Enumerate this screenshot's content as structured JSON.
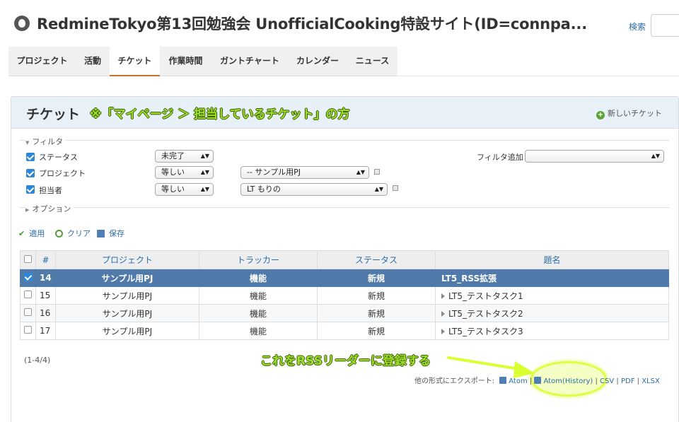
{
  "header": {
    "site_title": "RedmineTokyo第13回勉強会 UnofficialCooking特設サイト(ID=connpa...",
    "search_label": "検索"
  },
  "tabs": [
    {
      "label": "プロジェクト"
    },
    {
      "label": "活動"
    },
    {
      "label": "チケット",
      "selected": true
    },
    {
      "label": "作業時間"
    },
    {
      "label": "ガントチャート"
    },
    {
      "label": "カレンダー"
    },
    {
      "label": "ニュース"
    }
  ],
  "page": {
    "title": "チケット",
    "annotation": "※「マイページ ＞ 担当しているチケット」の方",
    "new_issue": "新しいチケット"
  },
  "filters": {
    "legend": "フィルタ",
    "add_filter_label": "フィルタ追加",
    "rows": [
      {
        "label": "ステータス",
        "operator": "未完了",
        "value": ""
      },
      {
        "label": "プロジェクト",
        "operator": "等しい",
        "value": "-- サンプル用PJ"
      },
      {
        "label": "担当者",
        "operator": "等しい",
        "value": "LT もりの"
      }
    ],
    "options_legend": "オプション"
  },
  "actions": {
    "apply": "適用",
    "clear": "クリア",
    "save": "保存"
  },
  "table": {
    "columns": [
      "#",
      "プロジェクト",
      "トラッカー",
      "ステータス",
      "題名"
    ],
    "rows": [
      {
        "id": "14",
        "project": "サンプル用PJ",
        "tracker": "機能",
        "status": "新規",
        "subject": "LT5_RSS拡張",
        "selected": true
      },
      {
        "id": "15",
        "project": "サンプル用PJ",
        "tracker": "機能",
        "status": "新規",
        "subject": "LT5_テストタスク1"
      },
      {
        "id": "16",
        "project": "サンプル用PJ",
        "tracker": "機能",
        "status": "新規",
        "subject": "LT5_テストタスク2"
      },
      {
        "id": "17",
        "project": "サンプル用PJ",
        "tracker": "機能",
        "status": "新規",
        "subject": "LT5_テストタスク3"
      }
    ],
    "count": "(1-4/4)"
  },
  "export": {
    "label": "他の形式にエクスポート:",
    "atom": "Atom",
    "atom_history": "Atom(History)",
    "csv": "CSV",
    "pdf": "PDF",
    "xlsx": "XLSX",
    "sep": "|"
  },
  "callout": "これをRSSリーダーに登録する",
  "colors": {
    "accent": "#c77226",
    "link": "#2a6ea6",
    "selected_row": "#507aaa",
    "annotation": "#9de02a"
  }
}
